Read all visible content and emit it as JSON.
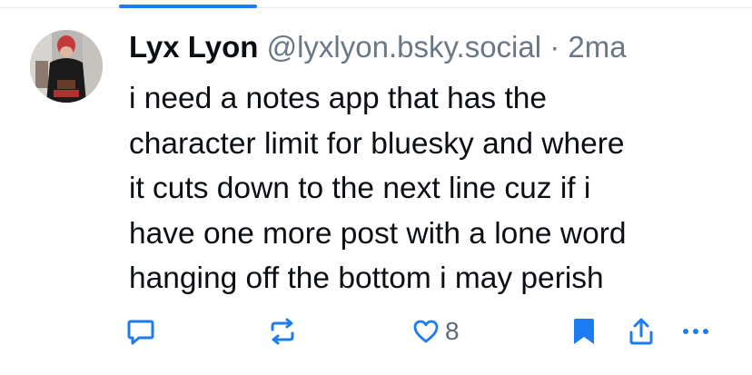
{
  "post": {
    "author_display_name": "Lyx Lyon",
    "author_handle": "@lyxlyon.bsky.social",
    "separator": "·",
    "timestamp": "2ma",
    "text": "i need a notes app that has the\ncharacter limit for bluesky and where\nit cuts down to the next line cuz if i\nhave one more post with a lone word\nhanging off the bottom i may perish"
  },
  "actions": {
    "reply_icon": "reply-bubble-icon",
    "repost_icon": "repost-icon",
    "like_icon": "heart-icon",
    "like_count": "8",
    "bookmark_icon": "bookmark-icon",
    "share_icon": "share-icon",
    "more_icon": "more-icon"
  },
  "colors": {
    "accent": "#1d7cf2",
    "text": "#0b0f14",
    "muted": "#6a7785",
    "icon": "#5c6b7a",
    "bookmark": "#1d7cf2"
  }
}
